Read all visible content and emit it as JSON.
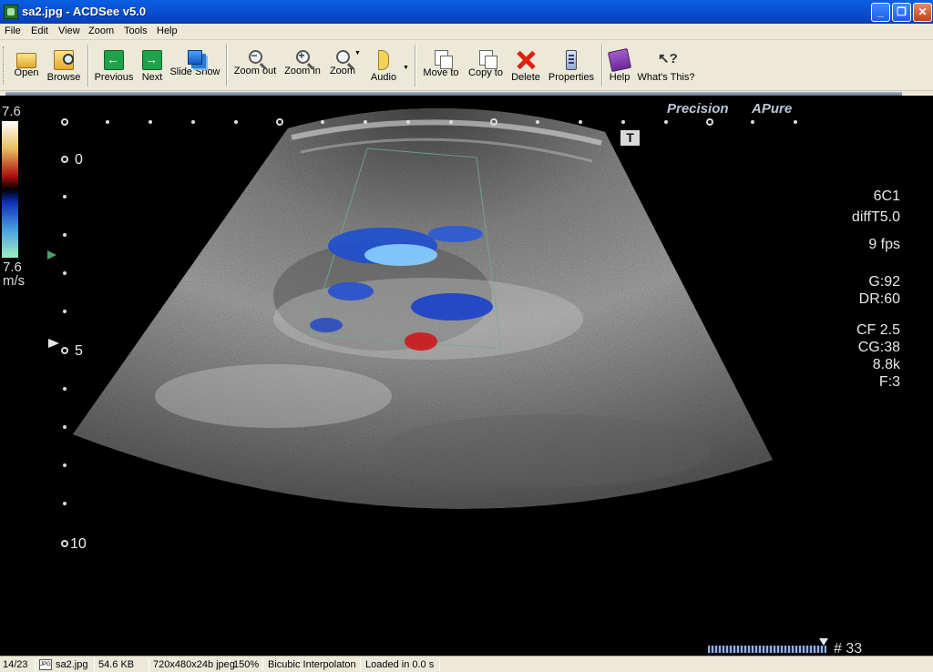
{
  "window": {
    "title": "sa2.jpg - ACDSee v5.0",
    "minimize": "_",
    "maximize": "❐",
    "close": "✕"
  },
  "menu": [
    "File",
    "Edit",
    "View",
    "Zoom",
    "Tools",
    "Help"
  ],
  "toolbar": {
    "open": "Open",
    "browse": "Browse",
    "previous": "Previous",
    "next": "Next",
    "slideshow": "Slide Show",
    "zoom_out": "Zoom out",
    "zoom_in": "Zoom in",
    "zoom": "Zoom",
    "audio": "Audio",
    "move_to": "Move to",
    "copy_to": "Copy to",
    "delete": "Delete",
    "properties": "Properties",
    "help": "Help",
    "whats_this": "What's This?"
  },
  "image": {
    "scale_top": "7.6",
    "scale_bottom": "7.6",
    "scale_unit": "m/s",
    "brand_left": "Precision",
    "brand_right": "Pure",
    "depth_0": "0",
    "depth_5": "5",
    "depth_10": "10",
    "params": {
      "probe": "6C1",
      "mode": "diffT5.0",
      "fps": "9 fps",
      "gain": "G:92",
      "dr": "DR:60",
      "cf": "CF 2.5",
      "cg": "CG:38",
      "prf": "8.8k",
      "filter": "F:3"
    },
    "t_marker": "T",
    "frame": "# 33"
  },
  "status": {
    "index": "14/23",
    "filename": "sa2.jpg",
    "filesize": "54.6 KB",
    "dimensions": "720x480x24b jpeg",
    "zoom": "150%",
    "interpolation": "Bicubic Interpolaton",
    "load": "Loaded in 0.0 s"
  },
  "colors": {
    "titlebar": "#0853d4",
    "chrome": "#ece9d8",
    "viewer_bg": "#000000"
  }
}
